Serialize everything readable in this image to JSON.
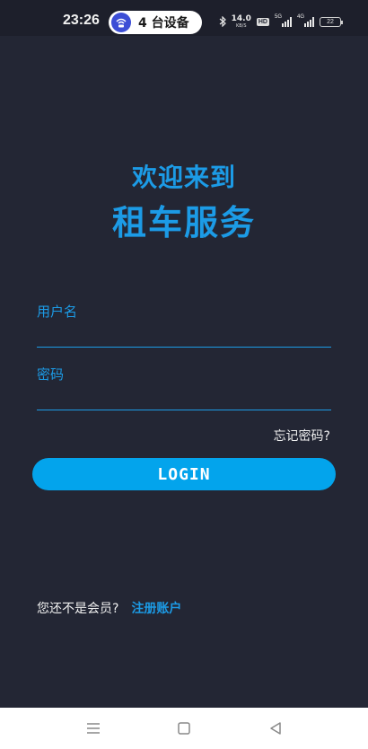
{
  "status_bar": {
    "time": "23:26",
    "device_pill": "4 台设备",
    "net_speed_value": "14.0",
    "net_speed_unit": "KB/S",
    "hd_label": "HD",
    "sig1_tag": "5G",
    "sig2_tag": "4G",
    "battery": "22"
  },
  "header": {
    "welcome": "欢迎来到",
    "title": "租车服务"
  },
  "form": {
    "username_label": "用户名",
    "username_value": "",
    "password_label": "密码",
    "password_value": "",
    "forgot_password": "忘记密码?",
    "login_button": "LOGIN"
  },
  "register": {
    "question": "您还不是会员?",
    "link": "注册账户"
  },
  "nav_bar": {
    "menu_icon": "menu-icon",
    "home_icon": "home-icon",
    "back_icon": "back-icon"
  },
  "colors": {
    "background": "#232634",
    "accent": "#1c9be6",
    "button": "#03a4ec"
  }
}
